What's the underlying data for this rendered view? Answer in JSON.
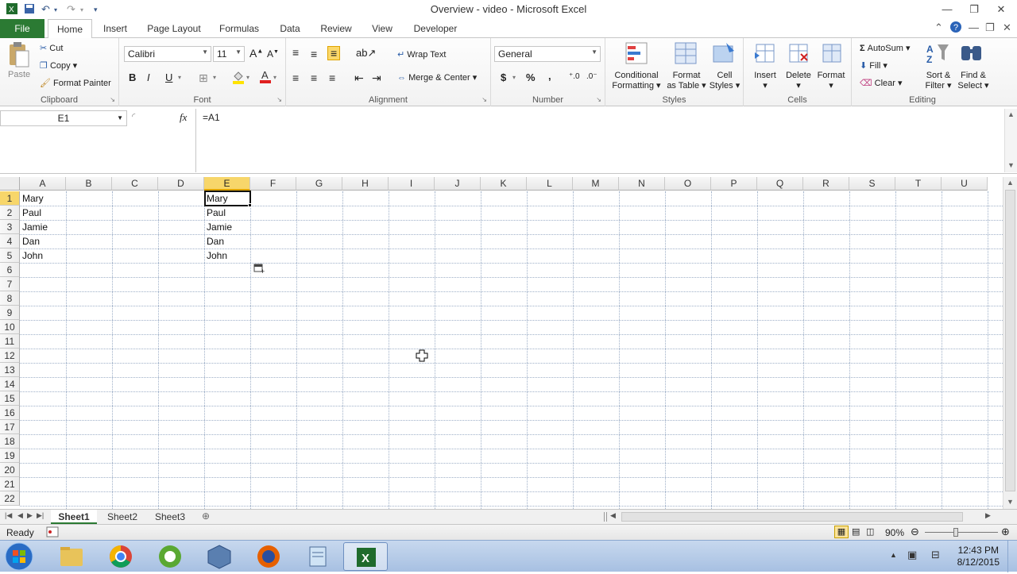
{
  "window": {
    "title": "Overview - video  -  Microsoft Excel"
  },
  "tabs": {
    "file": "File",
    "items": [
      "Home",
      "Insert",
      "Page Layout",
      "Formulas",
      "Data",
      "Review",
      "View",
      "Developer"
    ],
    "active": "Home"
  },
  "ribbon": {
    "clipboard": {
      "paste": "Paste",
      "cut": "Cut",
      "copy": "Copy",
      "format_painter": "Format Painter",
      "label": "Clipboard"
    },
    "font": {
      "name": "Calibri",
      "size": "11",
      "bold": "B",
      "italic": "I",
      "underline": "U",
      "label": "Font"
    },
    "alignment": {
      "wrap_text": "Wrap Text",
      "merge_center": "Merge & Center",
      "label": "Alignment"
    },
    "number": {
      "format": "General",
      "currency": "$",
      "percent": "%",
      "comma": ",",
      "label": "Number"
    },
    "styles": {
      "conditional": [
        "Conditional",
        "Formatting"
      ],
      "format_table": [
        "Format",
        "as Table"
      ],
      "cell_styles": [
        "Cell",
        "Styles"
      ],
      "label": "Styles"
    },
    "cells": {
      "insert": "Insert",
      "delete": "Delete",
      "format": "Format",
      "label": "Cells"
    },
    "editing": {
      "autosum": "AutoSum",
      "fill": "Fill",
      "clear": "Clear",
      "sort": [
        "Sort &",
        "Filter"
      ],
      "find": [
        "Find &",
        "Select"
      ],
      "label": "Editing"
    }
  },
  "formula_bar": {
    "name_box": "E1",
    "fx": "fx",
    "formula": "=A1"
  },
  "grid": {
    "columns": [
      "A",
      "B",
      "C",
      "D",
      "E",
      "F",
      "G",
      "H",
      "I",
      "J",
      "K",
      "L",
      "M",
      "N",
      "O",
      "P",
      "Q",
      "R",
      "S",
      "T",
      "U"
    ],
    "rows": [
      "1",
      "2",
      "3",
      "4",
      "5",
      "6",
      "7",
      "8",
      "9",
      "10",
      "11",
      "12",
      "13",
      "14",
      "15",
      "16",
      "17",
      "18",
      "19",
      "20",
      "21",
      "22"
    ],
    "selected_column": "E",
    "selected_row": "1",
    "column_a": [
      "Mary",
      "Paul",
      "Jamie",
      "Dan",
      "John"
    ],
    "column_e": [
      "Mary",
      "Paul",
      "Jamie",
      "Dan",
      "John"
    ]
  },
  "sheets": [
    "Sheet1",
    "Sheet2",
    "Sheet3"
  ],
  "status": {
    "ready": "Ready",
    "zoom": "90%"
  },
  "taskbar": {
    "time": "12:43 PM",
    "date": "8/12/2015"
  },
  "colors": {
    "accent": "#2b7a33",
    "selection": "#f7d66a",
    "ribbon_icon": "#2a5da8"
  }
}
